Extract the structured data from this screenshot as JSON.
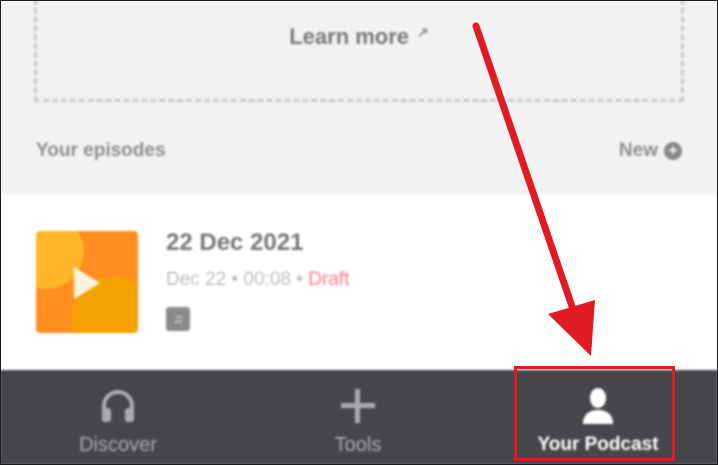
{
  "banner": {
    "learn_more_label": "Learn more"
  },
  "episodes_section": {
    "title": "Your episodes",
    "new_label": "New"
  },
  "episode": {
    "title": "22 Dec 2021",
    "date": "Dec 22",
    "duration": "00:08",
    "status": "Draft",
    "separator": "•"
  },
  "tabbar": {
    "tabs": [
      {
        "label": "Discover",
        "icon": "headphones-icon"
      },
      {
        "label": "Tools",
        "icon": "plus-icon"
      },
      {
        "label": "Your Podcast",
        "icon": "person-icon"
      }
    ],
    "active_index": 2
  },
  "colors": {
    "tabbar_bg": "#45474b",
    "annotation": "#e01b24",
    "draft": "#ff7a8a",
    "thumbnail": "#ff8d1f"
  }
}
